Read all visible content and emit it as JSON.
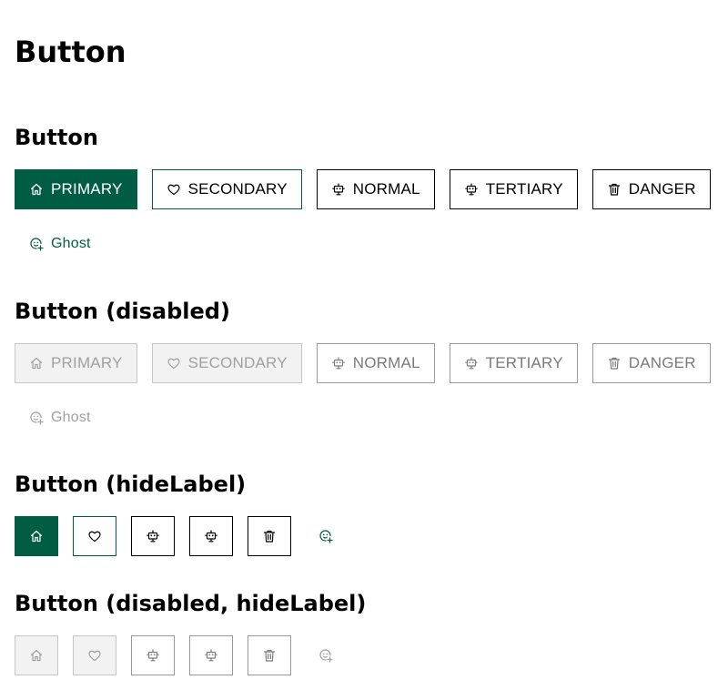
{
  "page": {
    "title": "Button"
  },
  "colors": {
    "brand": "#005d44",
    "disabled_fill": "#f2f2f2",
    "disabled_border": "#c6c6c6",
    "disabled_text": "#a0a0a0"
  },
  "sections": [
    {
      "title": "Button",
      "buttons": [
        {
          "label": "PRIMARY",
          "icon": "home-icon"
        },
        {
          "label": "SECONDARY",
          "icon": "heart-icon"
        },
        {
          "label": "NORMAL",
          "icon": "robot-icon"
        },
        {
          "label": "TERTIARY",
          "icon": "robot-icon"
        },
        {
          "label": "DANGER",
          "icon": "trash-icon"
        },
        {
          "label": "Ghost",
          "icon": "face-add-icon"
        }
      ]
    },
    {
      "title": "Button (disabled)",
      "buttons": [
        {
          "label": "PRIMARY",
          "icon": "home-icon"
        },
        {
          "label": "SECONDARY",
          "icon": "heart-icon"
        },
        {
          "label": "NORMAL",
          "icon": "robot-icon"
        },
        {
          "label": "TERTIARY",
          "icon": "robot-icon"
        },
        {
          "label": "DANGER",
          "icon": "trash-icon"
        },
        {
          "label": "Ghost",
          "icon": "face-add-icon"
        }
      ]
    },
    {
      "title": "Button (hideLabel)"
    },
    {
      "title": "Button (disabled, hideLabel)"
    }
  ]
}
